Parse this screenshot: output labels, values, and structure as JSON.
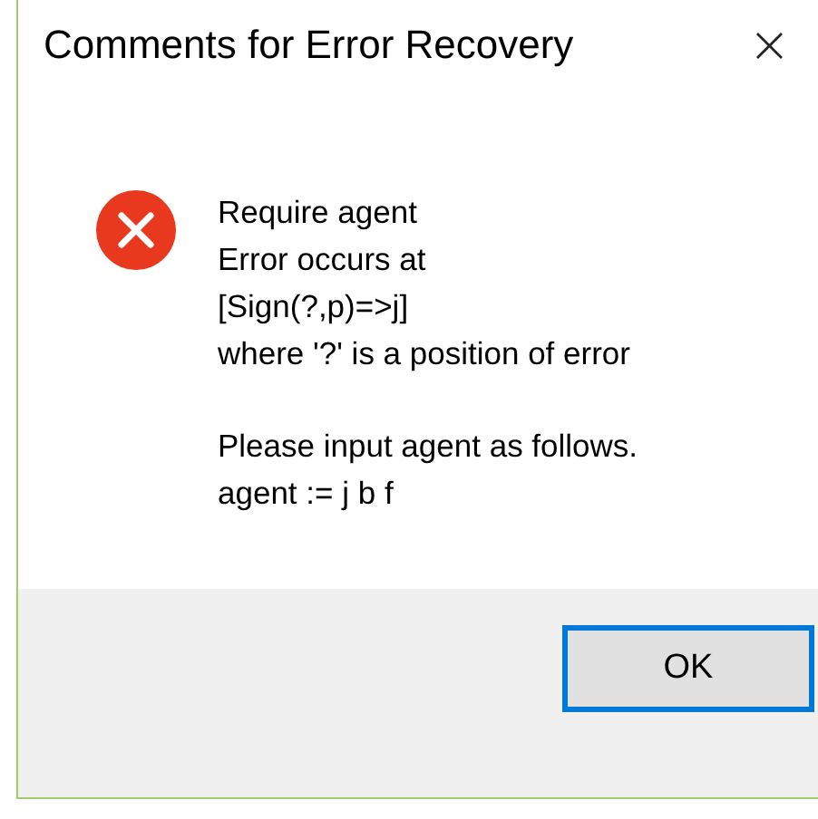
{
  "window": {
    "title": "Comments for Error Recovery",
    "close": "×"
  },
  "message": {
    "kind": "error",
    "paragraphs": [
      [
        "Require agent",
        "Error occurs at",
        "[Sign(?,p)=>j]",
        "where '?' is a position of error"
      ],
      [
        "Please input agent as follows.",
        "agent := j b f"
      ]
    ]
  },
  "buttons": [
    {
      "label": "OK",
      "default": true
    }
  ]
}
